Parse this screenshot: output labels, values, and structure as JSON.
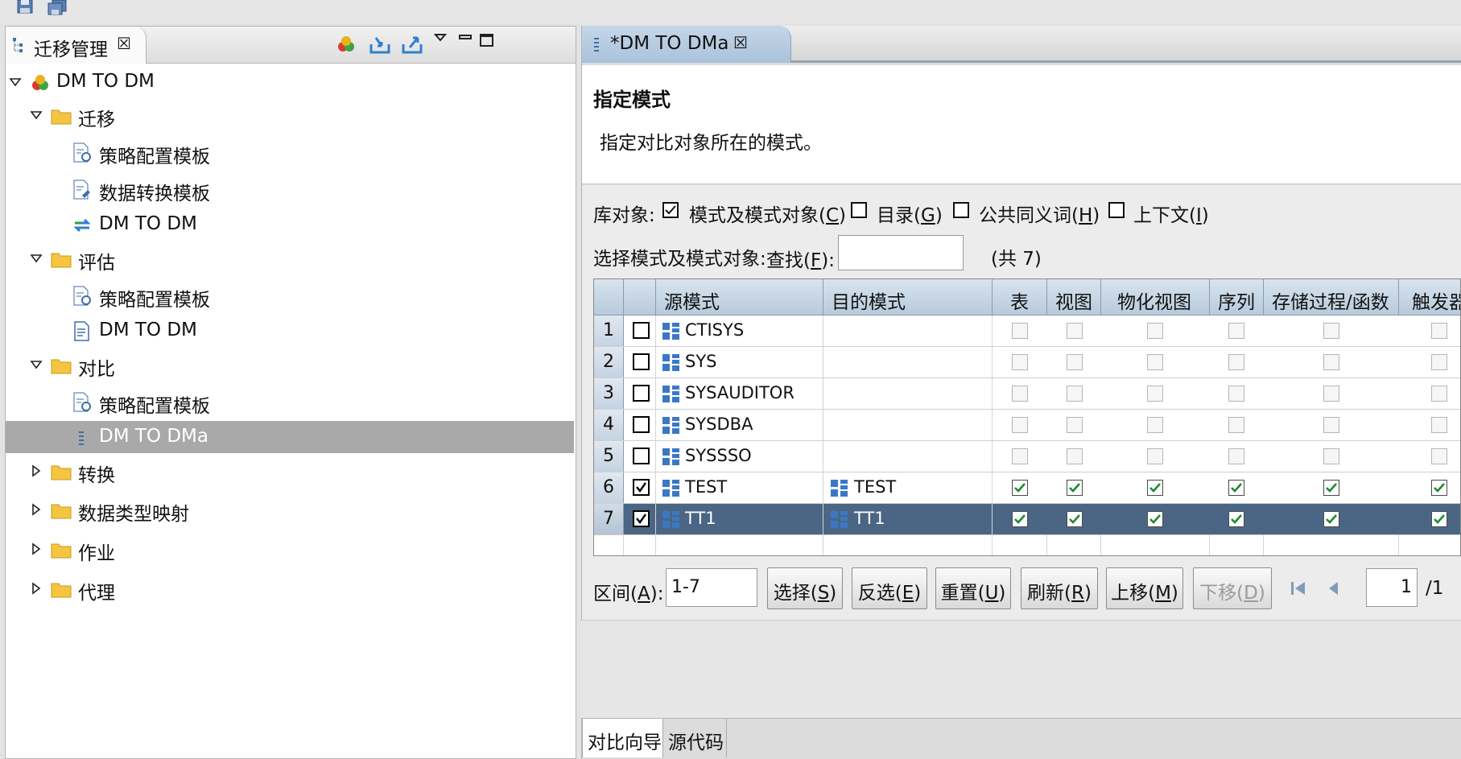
{
  "left_view": {
    "tab_label": "迁移管理",
    "tab_close": "☒",
    "tree": [
      {
        "label": "DM TO DM",
        "icon": "project-icon",
        "twisty": "expanded"
      },
      {
        "label": "迁移",
        "icon": "folder-icon",
        "twisty": "expanded"
      },
      {
        "label": "策略配置模板",
        "icon": "template-icon",
        "twisty": ""
      },
      {
        "label": "数据转换模板",
        "icon": "template-icon",
        "twisty": ""
      },
      {
        "label": "DM TO DM",
        "icon": "migrate-arrows-icon",
        "twisty": ""
      },
      {
        "label": "评估",
        "icon": "folder-icon",
        "twisty": "expanded"
      },
      {
        "label": "策略配置模板",
        "icon": "template-icon",
        "twisty": ""
      },
      {
        "label": "DM TO DM",
        "icon": "document-icon",
        "twisty": ""
      },
      {
        "label": "对比",
        "icon": "folder-icon",
        "twisty": "expanded"
      },
      {
        "label": "策略配置模板",
        "icon": "template-icon",
        "twisty": ""
      },
      {
        "label": "DM TO DMa",
        "icon": "compare-icon",
        "twisty": "",
        "selected": true
      },
      {
        "label": "转换",
        "icon": "folder-icon",
        "twisty": "collapsed"
      },
      {
        "label": "数据类型映射",
        "icon": "folder-icon",
        "twisty": "collapsed"
      },
      {
        "label": "作业",
        "icon": "folder-icon",
        "twisty": "collapsed"
      },
      {
        "label": "代理",
        "icon": "folder-icon",
        "twisty": "collapsed"
      }
    ]
  },
  "editor": {
    "tab_label": "*DM TO DMa",
    "tab_close": "☒",
    "title": "指定模式",
    "description": "指定对比对象所在的模式。",
    "objects": {
      "label": "库对象:",
      "options": [
        {
          "label": "模式及模式对象(",
          "key": "C",
          "end": ")",
          "checked": true
        },
        {
          "label": "目录(",
          "key": "G",
          "end": ")",
          "checked": false
        },
        {
          "label": "公共同义词(",
          "key": "H",
          "end": ")",
          "checked": false
        },
        {
          "label": "上下文(",
          "key": "I",
          "end": ")",
          "checked": false
        }
      ]
    },
    "search": {
      "label": "选择模式及模式对象:",
      "find_label": "查找(",
      "find_key": "F",
      "find_end": "):",
      "value": "",
      "count": "(共 7)"
    },
    "table": {
      "columns": [
        "源模式",
        "目的模式",
        "表",
        "视图",
        "物化视图",
        "序列",
        "存储过程/函数",
        "触发器"
      ],
      "rows": [
        {
          "num": "1",
          "selected": false,
          "source": "CTISYS",
          "target": "",
          "flags": [
            false,
            false,
            false,
            false,
            false,
            false
          ]
        },
        {
          "num": "2",
          "selected": false,
          "source": "SYS",
          "target": "",
          "flags": [
            false,
            false,
            false,
            false,
            false,
            false
          ]
        },
        {
          "num": "3",
          "selected": false,
          "source": "SYSAUDITOR",
          "target": "",
          "flags": [
            false,
            false,
            false,
            false,
            false,
            false
          ]
        },
        {
          "num": "4",
          "selected": false,
          "source": "SYSDBA",
          "target": "",
          "flags": [
            false,
            false,
            false,
            false,
            false,
            false
          ]
        },
        {
          "num": "5",
          "selected": false,
          "source": "SYSSSO",
          "target": "",
          "flags": [
            false,
            false,
            false,
            false,
            false,
            false
          ]
        },
        {
          "num": "6",
          "selected": true,
          "source": "TEST",
          "target": "TEST",
          "flags": [
            true,
            true,
            true,
            true,
            true,
            true
          ]
        },
        {
          "num": "7",
          "selected": true,
          "highlighted": true,
          "source": "TT1",
          "target": "TT1",
          "flags": [
            true,
            true,
            true,
            true,
            true,
            true
          ]
        }
      ]
    },
    "range": {
      "label": "区间(",
      "key": "A",
      "end": "):",
      "value": "1-7"
    },
    "buttons": [
      {
        "label": "选择(",
        "key": "S",
        "end": ")",
        "enabled": true
      },
      {
        "label": "反选(",
        "key": "E",
        "end": ")",
        "enabled": true
      },
      {
        "label": "重置(",
        "key": "U",
        "end": ")",
        "enabled": true
      },
      {
        "label": "刷新(",
        "key": "R",
        "end": ")",
        "enabled": true
      },
      {
        "label": "上移(",
        "key": "M",
        "end": ")",
        "enabled": true
      },
      {
        "label": "下移(",
        "key": "D",
        "end": ")",
        "enabled": false
      }
    ],
    "pager": {
      "page": "1",
      "total": "/1"
    },
    "bottom_tabs": [
      "对比向导",
      "源代码"
    ]
  }
}
